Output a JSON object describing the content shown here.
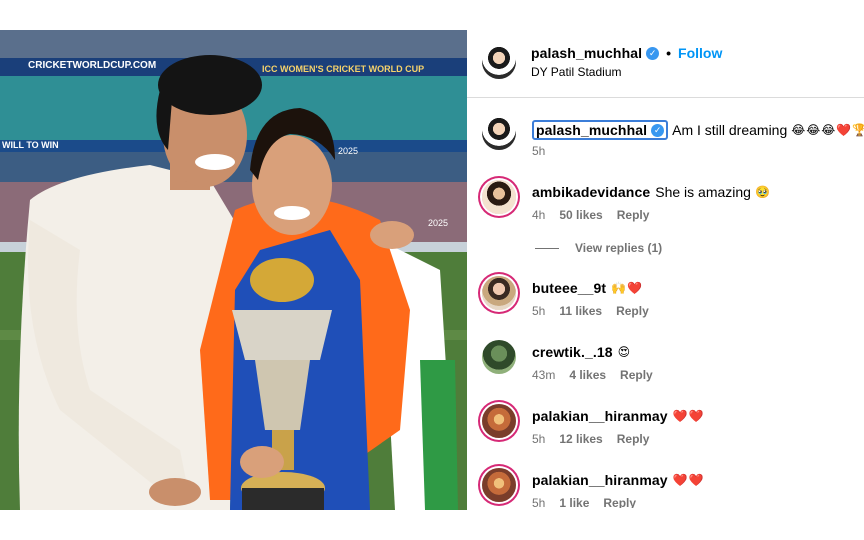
{
  "post": {
    "stadium_banner_left": "CRICKETWORLDCUP.COM",
    "stadium_banner_right": "ICC WOMEN'S CRICKET WORLD CUP",
    "stadium_board": "WILL TO WIN",
    "board_2025_top": "2025",
    "board_2025_bottom": "2025"
  },
  "header": {
    "username": "palash_muchhal",
    "verified": "✓",
    "separator": "•",
    "follow_label": "Follow",
    "location": "DY Patil Stadium"
  },
  "caption": {
    "username": "palash_muchhal",
    "verified": "✓",
    "text": "Am I still dreaming",
    "emojis": "😂😂😂",
    "heart": "❤️",
    "trophy": "🏆",
    "time": "5h"
  },
  "comments": [
    {
      "username": "ambikadevidance",
      "text": "She is amazing",
      "emoji": "🥹",
      "time": "4h",
      "likes": "50 likes",
      "reply": "Reply"
    },
    {
      "username": "buteee__9t",
      "text": "",
      "emoji": "🙌",
      "heart": "❤️",
      "time": "5h",
      "likes": "11 likes",
      "reply": "Reply"
    },
    {
      "username": "crewtik._.18",
      "text": "",
      "emoji": "😍",
      "time": "43m",
      "likes": "4 likes",
      "reply": "Reply"
    },
    {
      "username": "palakian__hiranmay",
      "text": "",
      "emoji": "",
      "heart": "❤️❤️",
      "time": "5h",
      "likes": "12 likes",
      "reply": "Reply"
    },
    {
      "username": "palakian__hiranmay",
      "text": "",
      "emoji": "",
      "heart": "❤️❤️",
      "time": "5h",
      "likes": "1 like",
      "reply": "Reply"
    }
  ],
  "view_replies": "View replies (1)",
  "colors": {
    "accent": "#0095f6",
    "verified": "#3897f0",
    "muted": "#737373",
    "heart": "#e0245e"
  }
}
